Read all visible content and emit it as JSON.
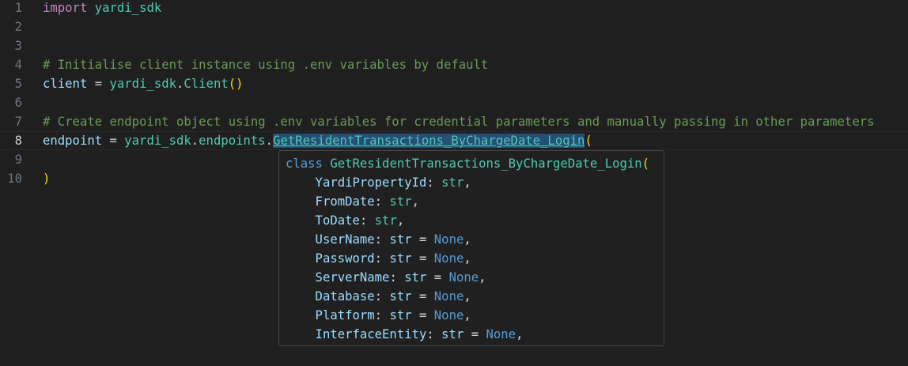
{
  "editor": {
    "lines": [
      {
        "num": "1",
        "tokens": [
          {
            "t": "import",
            "c": "kw"
          },
          {
            "t": " ",
            "c": "plain"
          },
          {
            "t": "yardi_sdk",
            "c": "mod"
          }
        ]
      },
      {
        "num": "2",
        "tokens": []
      },
      {
        "num": "3",
        "tokens": []
      },
      {
        "num": "4",
        "tokens": [
          {
            "t": "# Initialise client instance using .env variables by default",
            "c": "cmt"
          }
        ]
      },
      {
        "num": "5",
        "tokens": [
          {
            "t": "client",
            "c": "var"
          },
          {
            "t": " = ",
            "c": "op"
          },
          {
            "t": "yardi_sdk",
            "c": "mod"
          },
          {
            "t": ".",
            "c": "plain"
          },
          {
            "t": "Client",
            "c": "cls"
          },
          {
            "t": "()",
            "c": "brk"
          }
        ]
      },
      {
        "num": "6",
        "tokens": []
      },
      {
        "num": "7",
        "tokens": [
          {
            "t": "# Create endpoint object using .env variables for credential parameters and manually passing in other parameters",
            "c": "cmt"
          }
        ]
      },
      {
        "num": "8",
        "tokens": [
          {
            "t": "endpoint",
            "c": "var"
          },
          {
            "t": " = ",
            "c": "op"
          },
          {
            "t": "yardi_sdk",
            "c": "mod"
          },
          {
            "t": ".",
            "c": "plain"
          },
          {
            "t": "endpoints",
            "c": "mod"
          },
          {
            "t": ".",
            "c": "plain"
          },
          {
            "t": "GetResidentTransactions_ByChargeDate_Login",
            "c": "cls hl"
          },
          {
            "t": "(",
            "c": "brk"
          }
        ]
      },
      {
        "num": "9",
        "tokens": []
      },
      {
        "num": "10",
        "tokens": [
          {
            "t": ")",
            "c": "brk"
          }
        ]
      }
    ],
    "active_line": "8"
  },
  "hover": {
    "lines": [
      [
        {
          "t": "class",
          "c": "h-kw"
        },
        {
          "t": " ",
          "c": "h-punct"
        },
        {
          "t": "GetResidentTransactions_ByChargeDate_Login",
          "c": "h-cls"
        },
        {
          "t": "(",
          "c": "h-brk"
        }
      ],
      [
        {
          "t": "    YardiPropertyId",
          "c": "h-param"
        },
        {
          "t": ": ",
          "c": "h-punct"
        },
        {
          "t": "str",
          "c": "h-type"
        },
        {
          "t": ",",
          "c": "h-punct"
        }
      ],
      [
        {
          "t": "    FromDate",
          "c": "h-param"
        },
        {
          "t": ": ",
          "c": "h-punct"
        },
        {
          "t": "str",
          "c": "h-type"
        },
        {
          "t": ",",
          "c": "h-punct"
        }
      ],
      [
        {
          "t": "    ToDate",
          "c": "h-param"
        },
        {
          "t": ": ",
          "c": "h-punct"
        },
        {
          "t": "str",
          "c": "h-type"
        },
        {
          "t": ",",
          "c": "h-punct"
        }
      ],
      [
        {
          "t": "    UserName",
          "c": "h-param"
        },
        {
          "t": ": ",
          "c": "h-punct"
        },
        {
          "t": "str",
          "c": "h-type-b"
        },
        {
          "t": " = ",
          "c": "h-punct"
        },
        {
          "t": "None",
          "c": "h-none"
        },
        {
          "t": ",",
          "c": "h-punct"
        }
      ],
      [
        {
          "t": "    Password",
          "c": "h-param"
        },
        {
          "t": ": ",
          "c": "h-punct"
        },
        {
          "t": "str",
          "c": "h-type-b"
        },
        {
          "t": " = ",
          "c": "h-punct"
        },
        {
          "t": "None",
          "c": "h-none"
        },
        {
          "t": ",",
          "c": "h-punct"
        }
      ],
      [
        {
          "t": "    ServerName",
          "c": "h-param"
        },
        {
          "t": ": ",
          "c": "h-punct"
        },
        {
          "t": "str",
          "c": "h-type-b"
        },
        {
          "t": " = ",
          "c": "h-punct"
        },
        {
          "t": "None",
          "c": "h-none"
        },
        {
          "t": ",",
          "c": "h-punct"
        }
      ],
      [
        {
          "t": "    Database",
          "c": "h-param"
        },
        {
          "t": ": ",
          "c": "h-punct"
        },
        {
          "t": "str",
          "c": "h-type-b"
        },
        {
          "t": " = ",
          "c": "h-punct"
        },
        {
          "t": "None",
          "c": "h-none"
        },
        {
          "t": ",",
          "c": "h-punct"
        }
      ],
      [
        {
          "t": "    Platform",
          "c": "h-param"
        },
        {
          "t": ": ",
          "c": "h-punct"
        },
        {
          "t": "str",
          "c": "h-type-b"
        },
        {
          "t": " = ",
          "c": "h-punct"
        },
        {
          "t": "None",
          "c": "h-none"
        },
        {
          "t": ",",
          "c": "h-punct"
        }
      ],
      [
        {
          "t": "    InterfaceEntity",
          "c": "h-param"
        },
        {
          "t": ": ",
          "c": "h-punct"
        },
        {
          "t": "str",
          "c": "h-type-b"
        },
        {
          "t": " = ",
          "c": "h-punct"
        },
        {
          "t": "None",
          "c": "h-none"
        },
        {
          "t": ",",
          "c": "h-punct"
        }
      ]
    ]
  },
  "colors": {
    "background": "#1f1f1f",
    "keyword": "#c586c0",
    "module": "#4ec9b0",
    "comment": "#6a9955",
    "bracket": "#ffd700",
    "hover_background": "#202020"
  }
}
